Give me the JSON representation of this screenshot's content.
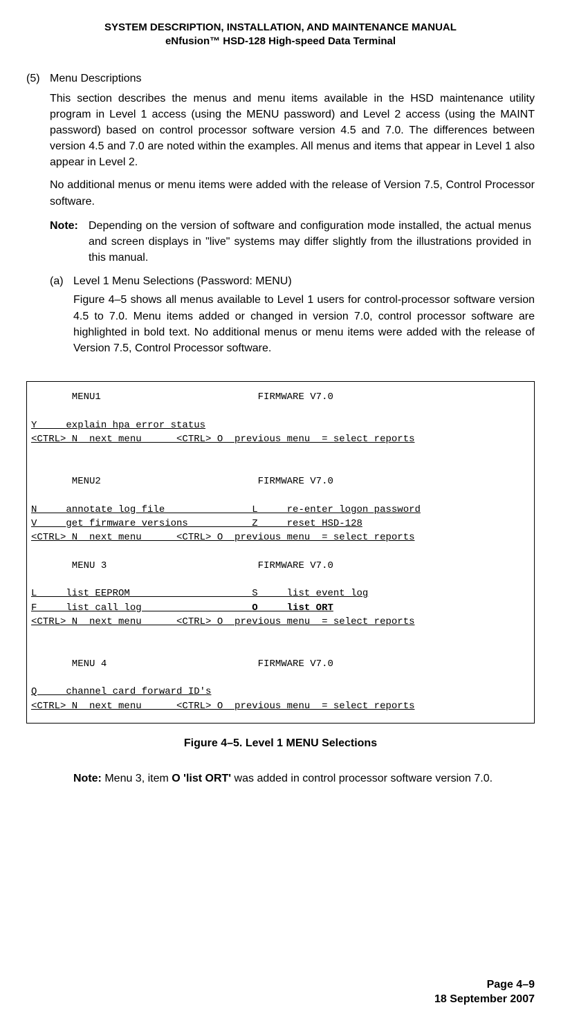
{
  "header": {
    "line1": "SYSTEM DESCRIPTION, INSTALLATION, AND MAINTENANCE MANUAL",
    "line2": "eNfusion™ HSD-128 High-speed Data Terminal"
  },
  "item5": {
    "tag": "(5)",
    "title": "Menu Descriptions",
    "para1": "This section describes the menus and menu items available in the HSD maintenance utility program in Level 1 access (using the MENU password) and Level 2 access (using the MAINT password) based on control processor software version 4.5 and 7.0. The differences between version 4.5 and 7.0 are noted within the examples. All menus and items that appear in Level 1 also appear in Level 2.",
    "para2": "No additional menus or menu items were added with the release of Version 7.5, Control Processor software.",
    "note_label": "Note:",
    "note_body": "Depending on the version of software and configuration mode installed, the actual menus and screen displays in \"live\" systems may differ slightly from the illustrations provided in this manual.",
    "sub_a": {
      "tag": "(a)",
      "title": "Level 1 Menu Selections (Password: MENU)",
      "body": "Figure 4–5 shows all menus available to Level 1 users for control-processor software version 4.5 to 7.0. Menu items added or changed in version 7.0, control processor software are highlighted in bold text. No additional menus or menu items were added with the release of Version 7.5, Control Processor software."
    }
  },
  "terminal": {
    "menu1_header": "       MENU1                           FIRMWARE V7.0",
    "menu1_y": "Y     explain hpa error status",
    "nav": "<CTRL> N  next menu      <CTRL> O  previous menu  = select reports",
    "menu2_header": "       MENU2                           FIRMWARE V7.0",
    "menu2_n": "N     annotate log file               L     re-enter logon password",
    "menu2_v": "V     get firmware versions           Z     reset HSD-128",
    "menu3_header": "       MENU 3                          FIRMWARE V7.0",
    "menu3_l": "L     list EEPROM                     S     list event log",
    "menu3_f_left": "F     list call log                   ",
    "menu3_f_bold": "O     list ORT",
    "menu4_header": "       MENU 4                          FIRMWARE V7.0",
    "menu4_q": "Q     channel card forward ID's"
  },
  "figure_caption": "Figure 4–5. Level 1 MENU Selections",
  "note2": {
    "label": "Note:",
    "before": " Menu 3, item ",
    "bold": "O 'list ORT'",
    "after": " was added in control processor software version 7.0."
  },
  "footer": {
    "page": "Page 4–9",
    "date": "18 September 2007"
  }
}
